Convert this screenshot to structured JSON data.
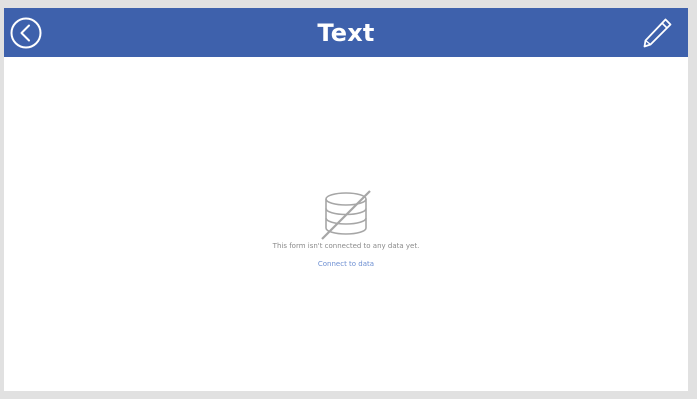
{
  "header": {
    "title": "Text",
    "back_icon": "back-arrow-circle-icon",
    "edit_icon": "pencil-icon",
    "background_color": "#3e61ac"
  },
  "form": {
    "empty_message": "This form isn't connected to any data yet.",
    "connect_link": "Connect to data",
    "database_icon": "database-disconnected-icon",
    "link_color": "#6d8fd2"
  }
}
